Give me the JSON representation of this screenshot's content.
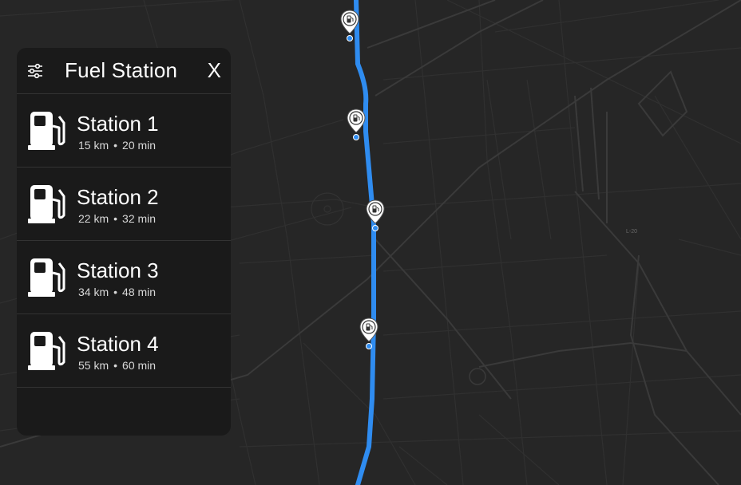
{
  "panel": {
    "title": "Fuel Station",
    "close_label": "X",
    "filter_icon": "filter-sliders-icon",
    "stations": [
      {
        "name": "Station 1",
        "distance": "15 km",
        "separator": "•",
        "time": "20 min"
      },
      {
        "name": "Station 2",
        "distance": "22 km",
        "separator": "•",
        "time": "32 min"
      },
      {
        "name": "Station 3",
        "distance": "34 km",
        "separator": "•",
        "time": "48 min"
      },
      {
        "name": "Station 4",
        "distance": "55 km",
        "separator": "•",
        "time": "60 min"
      }
    ]
  },
  "map": {
    "road_label": "L-20",
    "route_color": "#2f8cf0",
    "marker_icon": "fuel-pin-icon",
    "markers": [
      "Station 1",
      "Station 2",
      "Station 3",
      "Station 4"
    ]
  },
  "colors": {
    "background": "#262626",
    "panel": "#1a1a1a",
    "road": "#3c3c3c",
    "text": "#ffffff"
  }
}
